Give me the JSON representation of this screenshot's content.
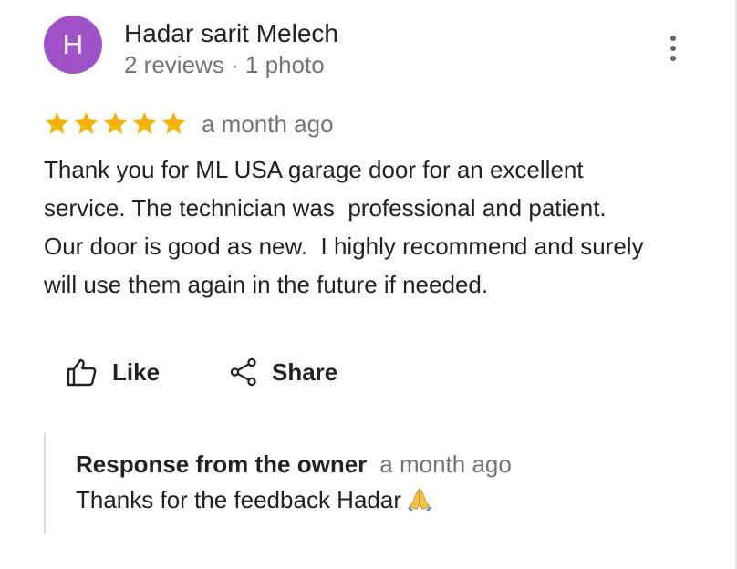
{
  "review": {
    "author": {
      "initial": "H",
      "name": "Hadar sarit Melech",
      "meta": "2 reviews · 1 photo",
      "avatar_color": "#a152c8"
    },
    "rating": 5,
    "star_color": "#f4b400",
    "time": "a month ago",
    "text": "Thank you for ML USA garage door for an excellent\nservice. The technician was  professional and patient.\nOur door is good as new.  I highly recommend and surely\nwill use them again in the future if needed.",
    "actions": {
      "like_label": "Like",
      "share_label": "Share"
    },
    "owner_response": {
      "label": "Response from the owner",
      "time": "a month ago",
      "text": "Thanks for the feedback Hadar"
    }
  },
  "icons": {
    "more": "more-vert-icon",
    "star": "star-icon",
    "like": "thumb-up-icon",
    "share": "share-icon",
    "response_emoji": "folded-hands-icon"
  }
}
